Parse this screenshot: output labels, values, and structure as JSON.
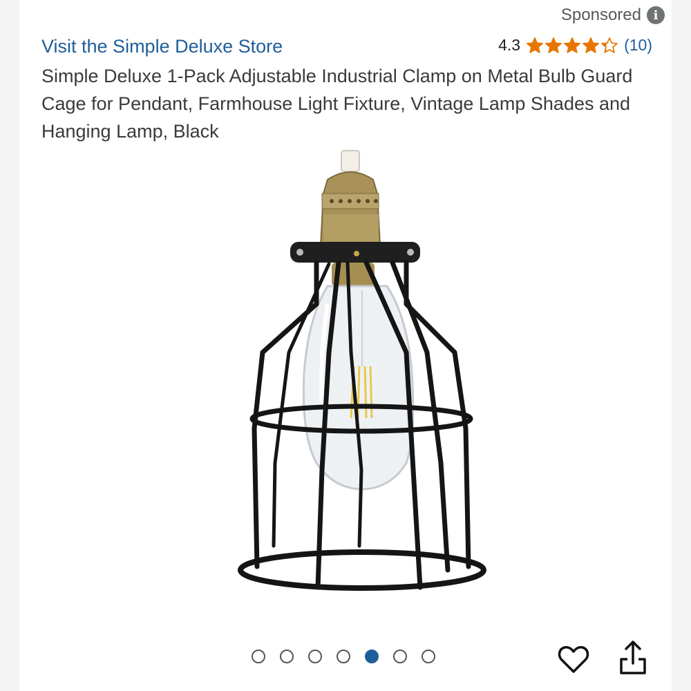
{
  "ad": {
    "sponsored_label": "Sponsored",
    "info_icon": "info-icon"
  },
  "store": {
    "link_text": "Visit the Simple Deluxe Store",
    "link_color": "#1f5e99"
  },
  "rating": {
    "value": "4.3",
    "stars_filled": 4.3,
    "stars_total": 5,
    "count": "(10)",
    "star_color": "#e77600"
  },
  "product": {
    "title": "Simple Deluxe 1-Pack Adjustable Industrial Clamp on Metal Bulb Guard Cage for Pendant, Farmhouse Light Fixture, Vintage Lamp Shades and Hanging Lamp, Black",
    "image_icon": "cage-pendant-lamp-image"
  },
  "carousel": {
    "total_images": 7,
    "active_index": 4,
    "active_color": "#1f5e99"
  },
  "actions": {
    "wishlist_icon": "heart-icon",
    "share_icon": "share-icon"
  }
}
